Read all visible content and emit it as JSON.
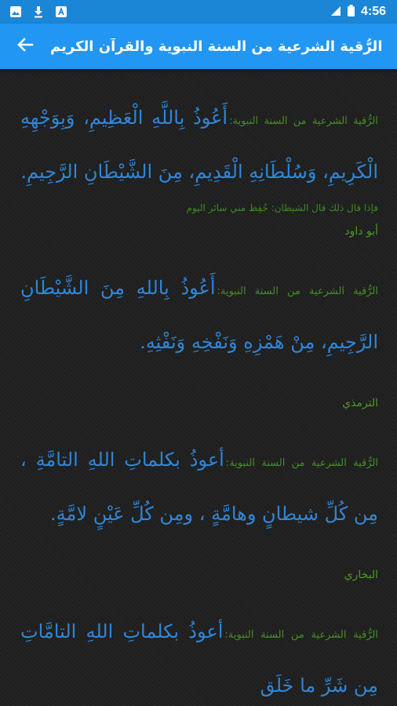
{
  "status_bar": {
    "icons": [
      "image-icon",
      "download-icon",
      "text-box-icon"
    ],
    "time": "4:56"
  },
  "app_bar": {
    "title": "الرُّقية الشرعية من السنة النبوية والقرآن الكريم"
  },
  "entries": [
    {
      "label": "الرُّقية الشرعية من السنة النبوية:",
      "text": "أَعُوذُ بِاللَّهِ الْعَظِيمِ، وَبِوَجْهِهِ الْكَرِيمِ، وَسُلْطَانِهِ الْقَدِيمِ، مِنَ الشَّيْطَانِ الرَّجِيمِ.",
      "note": "فإذا قال ذلك قال الشيطان: حُفِظ مني سائر اليوم",
      "source": "أبو داود"
    },
    {
      "label": "الرُّقية الشرعية من السنة النبوية:",
      "text": "أَعُوذُ بِاللهِ مِنَ الشَّيْطَانِ الرَّجِيمِ، مِنْ هَمْزِهِ وَنَفْخِهِ وَنَفْثِهِ.",
      "source": "الترمذي"
    },
    {
      "label": "الرُّقية الشرعية من السنة النبوية:",
      "text": "أعوذُ بكلماتِ اللهِ التامَّةِ ، مِن كُلِّ شيطانٍ وهامَّةٍ ، ومِن كُلِّ عَيْنٍ لامَّةٍ.",
      "source": "البخاري"
    },
    {
      "label": "الرُّقية الشرعية من السنة النبوية:",
      "text": "أعوذُ بكلماتِ اللهِ التامَّاتِ مِن شَرِّ ما خَلَق"
    }
  ]
}
